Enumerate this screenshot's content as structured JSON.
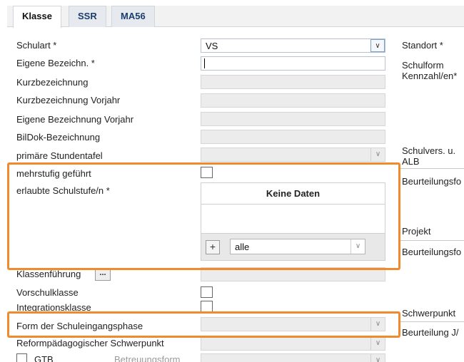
{
  "tabs": [
    "Klasse",
    "SSR",
    "MA56"
  ],
  "left_labels": {
    "schulart": "Schulart *",
    "eigene_bez": "Eigene Bezeichn. *",
    "kurzbez": "Kurzbezeichnung",
    "kurzbez_vorjahr": "Kurzbezeichnung Vorjahr",
    "eigene_bez_vorjahr": "Eigene Bezeichnung Vorjahr",
    "bildok": "BilDok-Bezeichnung",
    "stundentafel": "primäre Stundentafel",
    "mehrstufig": "mehrstufig geführt",
    "schulstufe": "erlaubte Schulstufe/n *",
    "klassenfuehrung": "Klassenführung",
    "vorschulklasse": "Vorschulklasse",
    "integrationsklasse": "Integrationsklasse",
    "schuleingangsphase": "Form der Schuleingangsphase",
    "reformpaed": "Reformpädagogischer Schwerpunkt",
    "gtb": "GTB",
    "betreuungsform": "Betreuungsform"
  },
  "values": {
    "schulart": "VS",
    "dots": "..."
  },
  "schulstufe_grid": {
    "empty_text": "Keine Daten",
    "add_label": "+",
    "filter_value": "alle"
  },
  "right_labels": {
    "standort": "Standort *",
    "schulform_1": "Schulform",
    "schulform_2": "Kennzahl/en*",
    "schulvers_1": "Schulvers. u.",
    "schulvers_2": "ALB",
    "beurteilungsform_1": "Beurteilungsfo",
    "projekt": "Projekt",
    "beurteilungsform_2": "Beurteilungsfo",
    "schwerpunkt": "Schwerpunkt",
    "beurteilung_ja": "Beurteilung J/"
  },
  "icons": {
    "dropdown": "chevron-down-icon",
    "add": "plus-icon"
  },
  "colors": {
    "highlight": "#f08a2c",
    "tab_text": "#1a3e6e"
  }
}
